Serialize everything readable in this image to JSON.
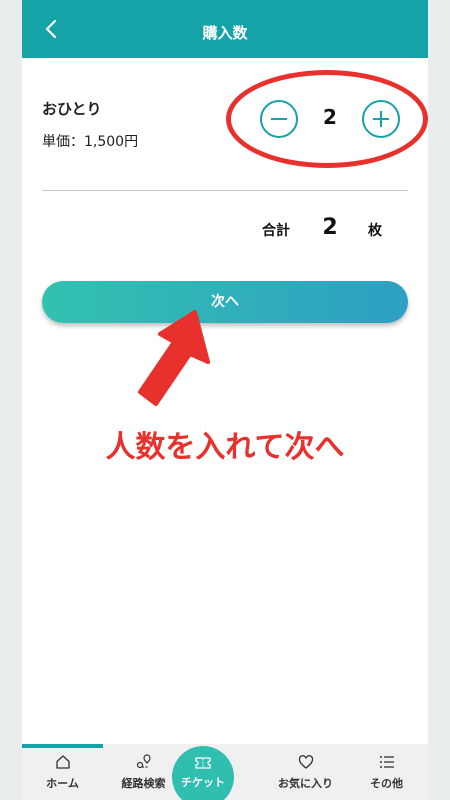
{
  "header": {
    "title": "購入数"
  },
  "ticket": {
    "passenger_type": "おひとり",
    "unit_price": "単価：1,500円",
    "quantity": "2"
  },
  "summary": {
    "label": "合計",
    "value": "2",
    "unit": "枚"
  },
  "actions": {
    "next_label": "次へ"
  },
  "annotation": {
    "text": "人数を入れて次へ"
  },
  "tabbar": {
    "home": "ホーム",
    "route": "経路検索",
    "ticket": "チケット",
    "favorites": "お気に入り",
    "other": "その他"
  },
  "colors": {
    "accent": "#16a3a7",
    "annotation_red": "#e8302c",
    "button_gradient_start": "#32c2b0",
    "button_gradient_end": "#2e9fc3"
  }
}
